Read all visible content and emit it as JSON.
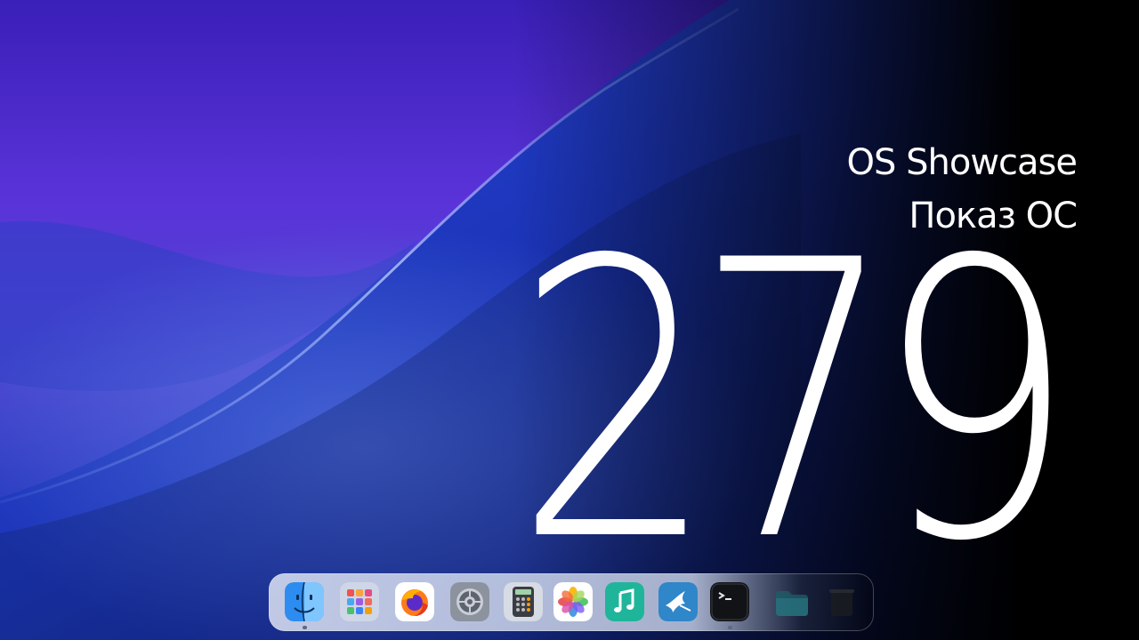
{
  "title_line_1": "OS Showcase",
  "title_line_2": "Показ ОС",
  "episode_number": "279",
  "colors": {
    "wallpaper_purple": "#5a2fd6",
    "wallpaper_blue": "#1f3cc8",
    "background_black": "#000000",
    "text": "#ffffff"
  },
  "dock": {
    "items": [
      {
        "name": "finder-icon",
        "running": true
      },
      {
        "name": "launchpad-icon",
        "running": false
      },
      {
        "name": "firefox-icon",
        "running": false
      },
      {
        "name": "system-settings-icon",
        "running": false
      },
      {
        "name": "calculator-icon",
        "running": false
      },
      {
        "name": "photos-icon",
        "running": false
      },
      {
        "name": "music-icon",
        "running": false
      },
      {
        "name": "swift-bird-icon",
        "running": false
      },
      {
        "name": "terminal-icon",
        "running": true
      },
      {
        "name": "folder-icon",
        "running": false
      },
      {
        "name": "trash-icon",
        "running": false
      }
    ]
  }
}
